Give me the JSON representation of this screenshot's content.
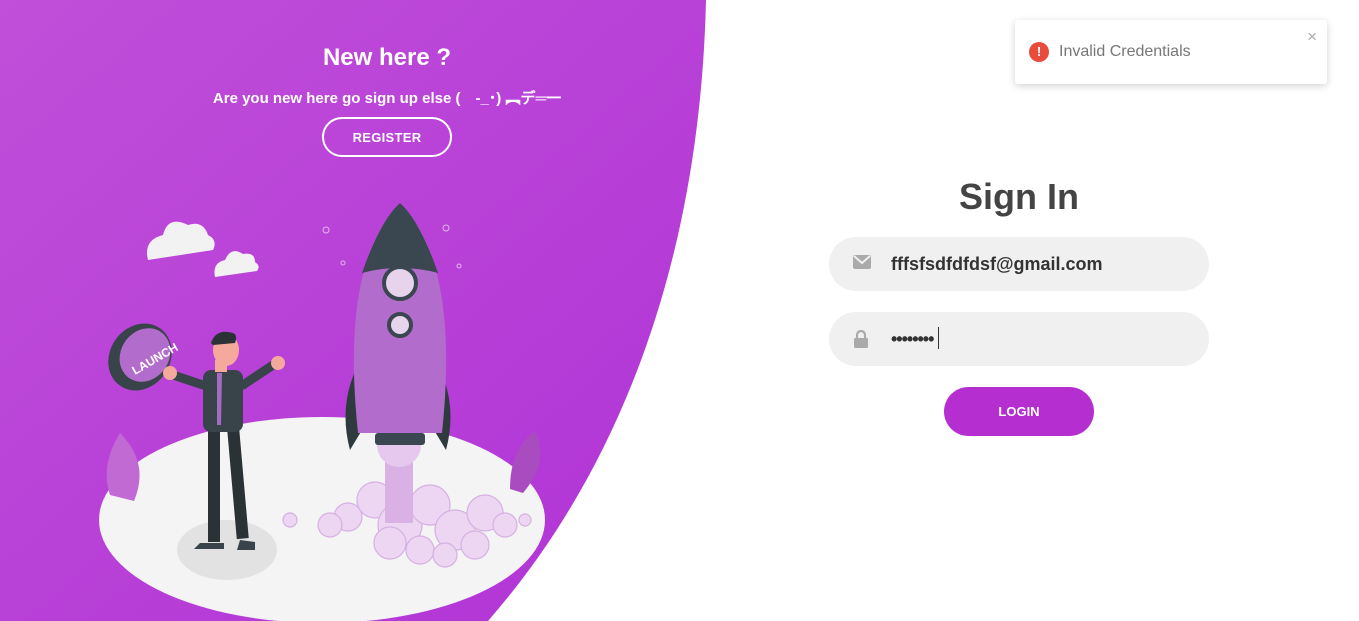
{
  "colors": {
    "accent": "#b52fd0",
    "panel_gradient_start": "#c04fd9",
    "panel_gradient_end": "#b033d6",
    "error": "#e74c3c"
  },
  "left_panel": {
    "title": "New here ?",
    "subtitle": "Are you new here go sign up else (　-_･) ︻デ═一",
    "register_label": "REGISTER",
    "illustration": {
      "button_label": "LAUNCH"
    }
  },
  "toast": {
    "icon": "error-icon",
    "icon_glyph": "!",
    "message": "Invalid Credentials",
    "close_glyph": "×"
  },
  "form": {
    "title": "Sign In",
    "email": {
      "icon": "envelope-icon",
      "value": "fffsfsdfdfdsf@gmail.com"
    },
    "password": {
      "icon": "lock-icon",
      "masked_value": "••••••••"
    },
    "login_label": "LOGIN"
  }
}
